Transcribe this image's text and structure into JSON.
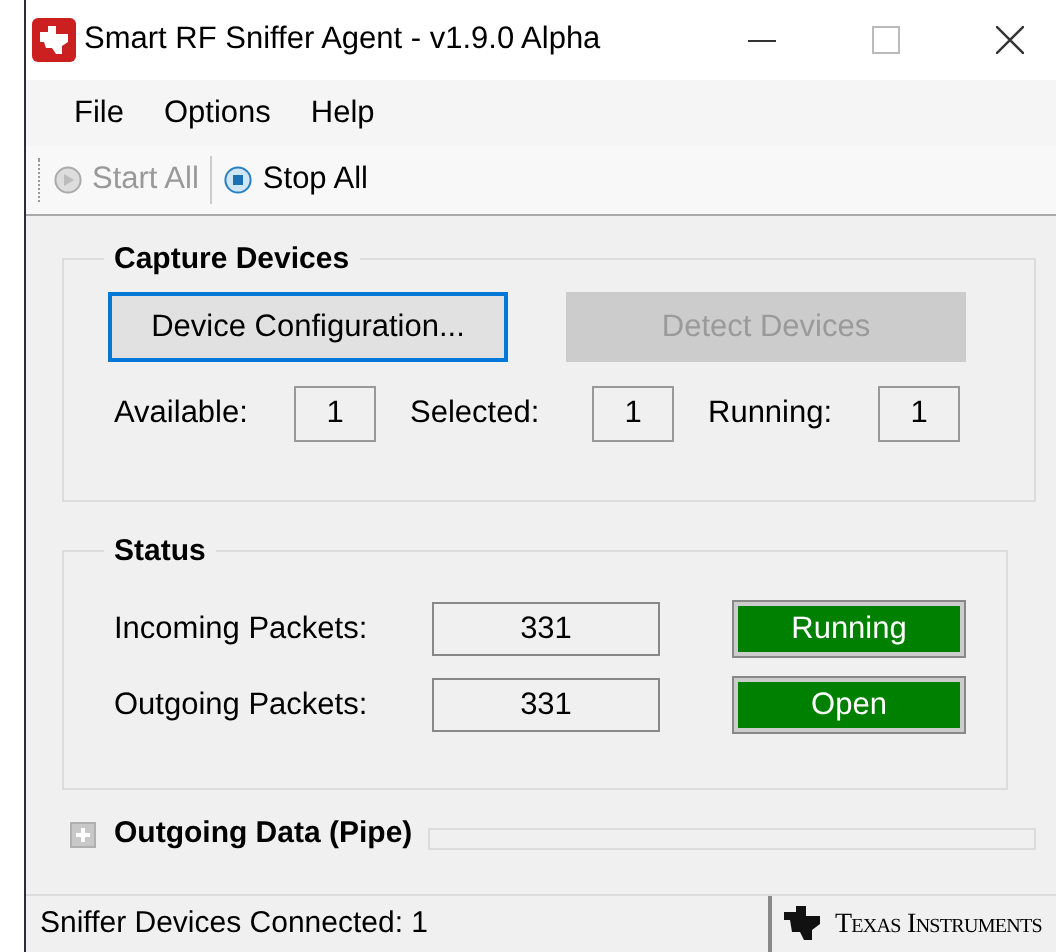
{
  "window": {
    "title": "Smart RF Sniffer Agent - v1.9.0 Alpha"
  },
  "menu": [
    "File",
    "Options",
    "Help"
  ],
  "toolbar": [
    {
      "label": "Start All",
      "kind": "start",
      "disabled": true
    },
    {
      "label": "Stop All",
      "kind": "stop",
      "disabled": false
    }
  ],
  "capture_devices": {
    "title": "Capture Devices",
    "buttons": [
      {
        "label": "Device Configuration...",
        "disabled": false,
        "focused": true
      },
      {
        "label": "Detect Devices",
        "disabled": true,
        "focused": false
      }
    ],
    "counters": [
      {
        "label": "Available:",
        "value": "1"
      },
      {
        "label": "Selected:",
        "value": "1"
      },
      {
        "label": "Running:",
        "value": "1"
      }
    ]
  },
  "status": {
    "title": "Status",
    "rows": [
      {
        "label": "Incoming Packets:",
        "value": "331",
        "state": "Running",
        "color": "#008000"
      },
      {
        "label": "Outgoing Packets:",
        "value": "331",
        "state": "Open",
        "color": "#008000"
      }
    ]
  },
  "outgoing_data": {
    "title": "Outgoing Data (Pipe)",
    "expanded": false
  },
  "status_bar": {
    "text": "Sniffer Devices Connected: 1",
    "logo_text": "Texas Instruments"
  }
}
